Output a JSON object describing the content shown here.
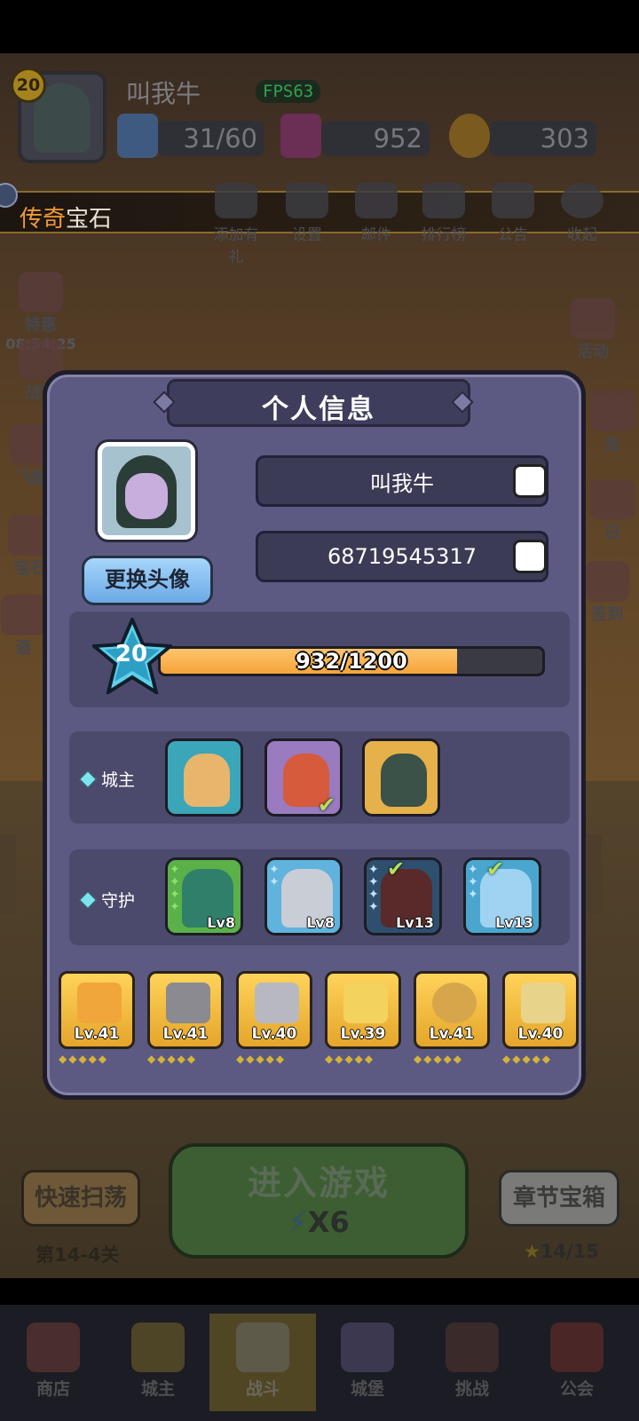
{
  "player": {
    "name": "叫我牛",
    "level": "20",
    "fps": "FPS63",
    "energy": "31/60",
    "gems": "952",
    "coins": "303"
  },
  "banner": {
    "title_highlight": "传奇",
    "title_rest": "宝石"
  },
  "top_menu": [
    "添加有礼",
    "设置",
    "邮件",
    "排行榜",
    "公告",
    "收起"
  ],
  "side_left": [
    {
      "label": "特惠",
      "timer": "08:54:25"
    },
    {
      "label": "战场"
    },
    {
      "label": "飞艇"
    },
    {
      "label": "宝石"
    },
    {
      "label": "酒"
    }
  ],
  "side_right": [
    "活动",
    "金",
    "日",
    "签到"
  ],
  "modal": {
    "title": "个人信息",
    "change_avatar": "更换头像",
    "name_value": "叫我牛",
    "id_value": "68719545317",
    "xp_level": "20",
    "xp_text": "932/1200",
    "xp_fraction": 0.777,
    "lord_label": "城主",
    "guard_label": "守护",
    "guards": [
      "Lv8",
      "Lv8",
      "Lv13",
      "Lv13"
    ],
    "equipment": [
      "Lv.41",
      "Lv.41",
      "Lv.40",
      "Lv.39",
      "Lv.41",
      "Lv.40"
    ]
  },
  "bottom": {
    "sweep": "快速扫荡",
    "stage": "第14-4关",
    "enter": "进入游戏",
    "cost": "X6",
    "chest": "章节宝箱",
    "chest_progress": "14/15"
  },
  "tabs": [
    "商店",
    "城主",
    "战斗",
    "城堡",
    "挑战",
    "公会"
  ],
  "colors": {
    "modal_bg": "#5c5a82",
    "xp_fill": "#f5a43a",
    "equip_bg": "#ffd35a",
    "accent_orange": "#f19a37"
  }
}
